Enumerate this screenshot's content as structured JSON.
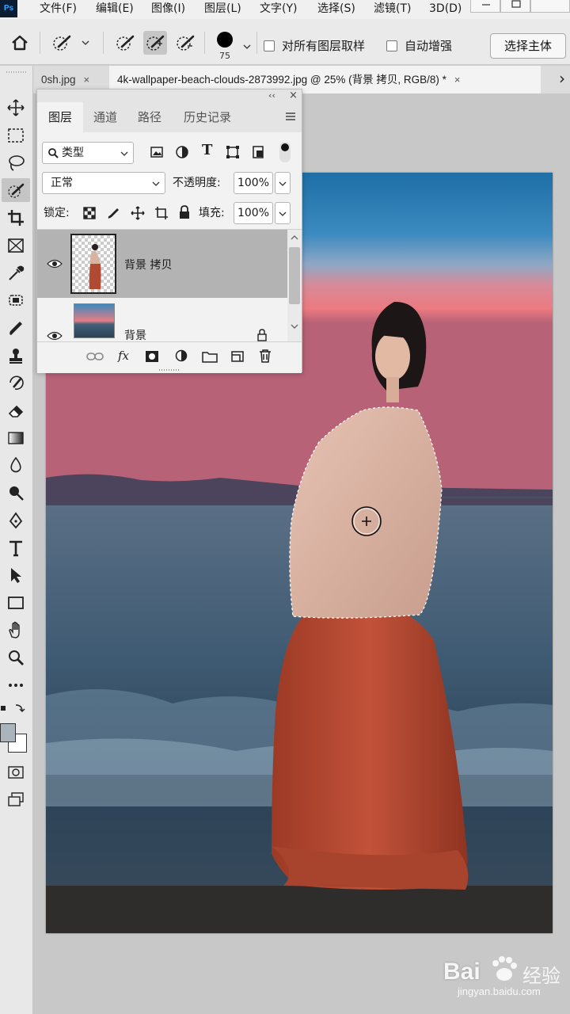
{
  "menubar": {
    "logo": "Ps",
    "items": [
      "文件(F)",
      "编辑(E)",
      "图像(I)",
      "图层(L)",
      "文字(Y)",
      "选择(S)",
      "滤镜(T)",
      "3D(D)"
    ]
  },
  "options": {
    "brush_size": "75",
    "sample_all_layers": "对所有图层取样",
    "auto_enhance": "自动增强",
    "select_subject": "选择主体"
  },
  "tabs": {
    "prev_tab": "0sh.jpg",
    "active_tab": "4k-wallpaper-beach-clouds-2873992.jpg @ 25% (背景 拷贝, RGB/8) *",
    "close": "×",
    "more": "›"
  },
  "layers_panel": {
    "collapse": "‹‹",
    "close": "×",
    "tabs": [
      "图层",
      "通道",
      "路径",
      "历史记录"
    ],
    "filter_kind": "类型",
    "blend_mode": "正常",
    "opacity_label": "不透明度:",
    "opacity_value": "100%",
    "lock_label": "锁定:",
    "fill_label": "填充:",
    "fill_value": "100%",
    "layers": [
      {
        "name": "背景 拷贝",
        "selected": true,
        "locked": false
      },
      {
        "name": "背景",
        "selected": false,
        "locked": true
      }
    ]
  },
  "watermark": {
    "brand": "Bai",
    "brand_suffix": "经验",
    "url": "jingyan.baidu.com"
  },
  "colors": {
    "accent": "#31a8ff",
    "selected_layer": "#b3b3b3",
    "menubar": "#f0f0f0",
    "toolbar": "#e8e8e8"
  }
}
